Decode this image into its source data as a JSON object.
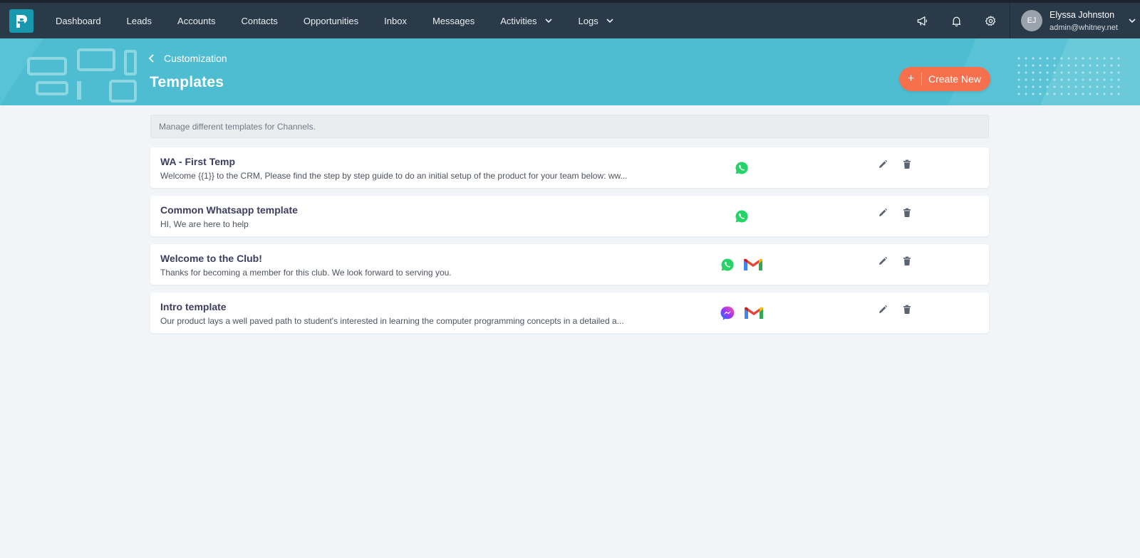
{
  "nav": {
    "items": [
      {
        "label": "Dashboard"
      },
      {
        "label": "Leads"
      },
      {
        "label": "Accounts"
      },
      {
        "label": "Contacts"
      },
      {
        "label": "Opportunities"
      },
      {
        "label": "Inbox"
      },
      {
        "label": "Messages"
      },
      {
        "label": "Activities",
        "dropdown": true
      },
      {
        "label": "Logs",
        "dropdown": true
      }
    ],
    "icons": [
      "megaphone-icon",
      "bell-icon",
      "gear-icon"
    ]
  },
  "user": {
    "initials": "EJ",
    "name": "Elyssa Johnston",
    "email": "admin@whitney.net"
  },
  "header": {
    "back_label": "Customization",
    "title": "Templates",
    "create_label": "Create New",
    "create_icon": "+"
  },
  "info": "Manage different templates for Channels.",
  "templates": [
    {
      "title": "WA - First Temp",
      "description": "Welcome {{1}} to the CRM, Please find the step by step guide to do an initial setup of the product for your team below: ww...",
      "channels": [
        "whatsapp"
      ]
    },
    {
      "title": "Common Whatsapp template",
      "description": "HI, We are here to help",
      "channels": [
        "whatsapp"
      ]
    },
    {
      "title": "Welcome to the Club!",
      "description": "Thanks for becoming a member for this club. We look forward to serving you.",
      "channels": [
        "whatsapp",
        "gmail"
      ]
    },
    {
      "title": "Intro template",
      "description": "Our product lays a well paved path to student's interested in learning the computer programming concepts in a detailed a...",
      "channels": [
        "messenger",
        "gmail"
      ]
    }
  ],
  "colors": {
    "topbar": "#2b3a48",
    "banner": "#4fbdd1",
    "accent": "#f7704e",
    "logo": "#1798ae",
    "whatsapp": "#25d366"
  }
}
